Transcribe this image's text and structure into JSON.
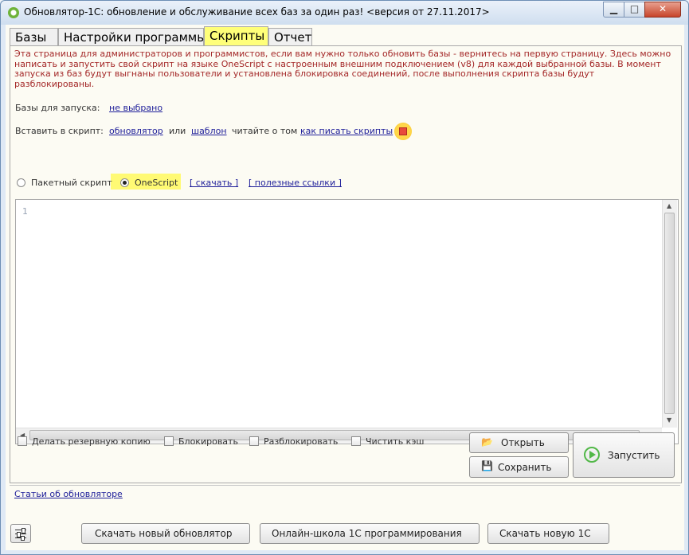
{
  "window": {
    "title": "Обновлятор-1С: обновление и обслуживание всех баз за один раз! <версия от 27.11.2017>",
    "min_glyph": "▁",
    "max_glyph": "□",
    "close_glyph": "✕"
  },
  "tabs": [
    {
      "label": "Базы"
    },
    {
      "label": "Настройки программы"
    },
    {
      "label": "Скрипты"
    },
    {
      "label": "Отчет"
    }
  ],
  "scripts": {
    "info_text": "Эта страница для администраторов и программистов, если вам нужно только обновить базы - вернитесь на первую страницу. Здесь можно написать и запустить свой скрипт на языке OneScript с настроенным внешним подключением (v8) для каждой выбранной базы. В момент запуска из баз будут выгнаны пользователи и установлена блокировка соединений, после выполнения скрипта базы будут разблокированы.",
    "bases_label": "Базы для запуска:",
    "bases_value": "не выбрано",
    "insert_label": "Вставить в скрипт:",
    "insert_updater": "обновлятор",
    "insert_or": "или",
    "insert_template": "шаблон",
    "read_about": "читайте о том",
    "how_to_write": "как писать скрипты",
    "radio_batch": "Пакетный скрипт",
    "radio_onescript": "OneScript",
    "download_link": "[ скачать ]",
    "useful_links": "[ полезные ссылки ]",
    "editor_line": "1",
    "selected_mode": "OneScript"
  },
  "options": [
    {
      "label": "Делать резервную копию",
      "checked": false
    },
    {
      "label": "Блокировать",
      "checked": false
    },
    {
      "label": "Разблокировать",
      "checked": false
    },
    {
      "label": "Чистить кэш",
      "checked": false
    }
  ],
  "actions": {
    "open": "Открыть",
    "save": "Сохранить",
    "run": "Запустить"
  },
  "footer": {
    "articles_link": "Статьи об обновляторе",
    "download_updater": "Скачать новый обновлятор",
    "online_school": "Онлайн-школа 1С программирования",
    "download_1c": "Скачать новую 1С"
  },
  "colors": {
    "accent_tab": "#ffff79",
    "info_text": "#a42828",
    "link": "#1f1f9a",
    "run_icon": "#52b848"
  }
}
